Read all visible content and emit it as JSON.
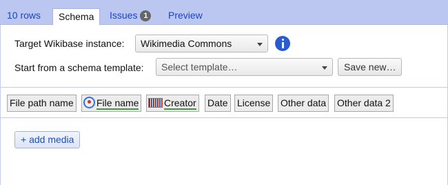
{
  "tabs": {
    "rows": "10 rows",
    "schema": "Schema",
    "issues": "Issues",
    "issues_count": "1",
    "preview": "Preview"
  },
  "settings": {
    "instance_label": "Target Wikibase instance:",
    "instance_value": "Wikimedia Commons",
    "template_label": "Start from a schema template:",
    "template_placeholder": "Select template…",
    "save_new": "Save new…"
  },
  "columns": [
    {
      "label": "File path name",
      "icon": null,
      "underlined": false
    },
    {
      "label": "File name",
      "icon": "commons-icon",
      "underlined": true
    },
    {
      "label": "Creator",
      "icon": "creator-icon",
      "underlined": true
    },
    {
      "label": "Date",
      "icon": null,
      "underlined": false
    },
    {
      "label": "License",
      "icon": null,
      "underlined": false
    },
    {
      "label": "Other data",
      "icon": null,
      "underlined": false
    },
    {
      "label": "Other data 2",
      "icon": null,
      "underlined": false
    }
  ],
  "add_media": "+ add media",
  "colors": {
    "tabbar": "#bcc7f1",
    "link": "#1b43c4",
    "info": "#2b5ccf",
    "underline": "#3a9d3a"
  }
}
